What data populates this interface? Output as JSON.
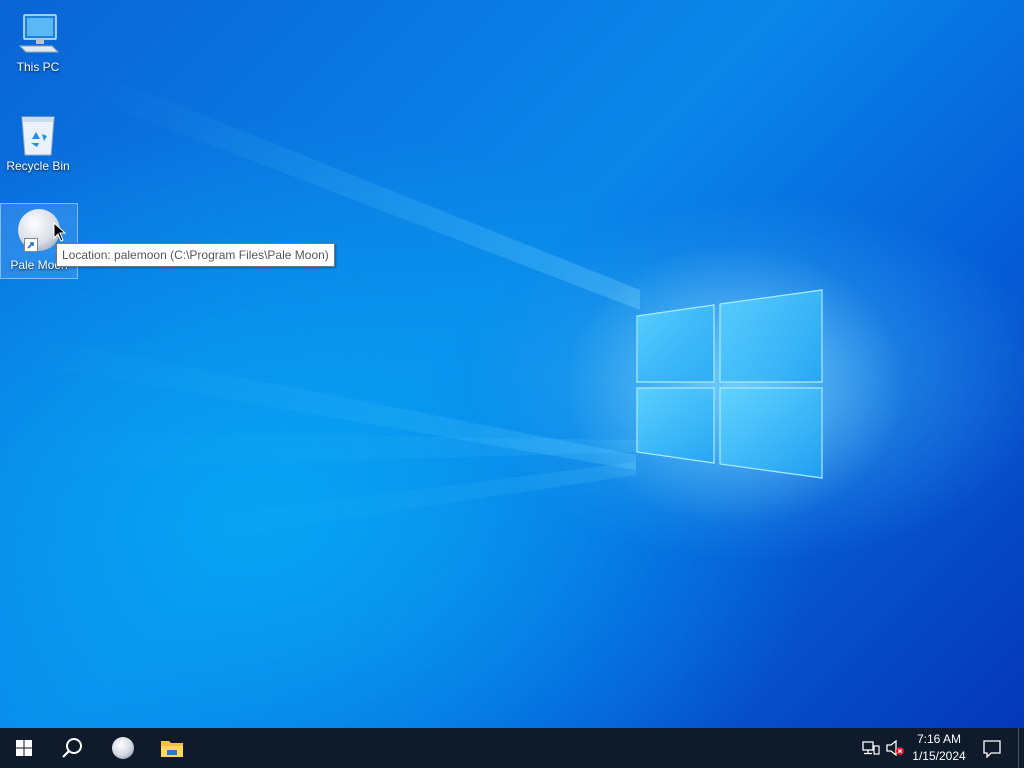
{
  "desktop": {
    "icons": [
      {
        "label": "This PC"
      },
      {
        "label": "Recycle Bin"
      },
      {
        "label": "Pale Moon"
      }
    ],
    "tooltip": "Location: palemoon (C:\\Program Files\\Pale Moon)"
  },
  "taskbar": {
    "clock": {
      "time": "7:16 AM",
      "date": "1/15/2024"
    },
    "pinned": [
      "start-button",
      "search-icon",
      "pale-moon-app",
      "file-explorer-app"
    ],
    "tray_icons": [
      "network-icon",
      "volume-muted-icon",
      "action-center-icon"
    ]
  },
  "colors": {
    "taskbar": "#0f1b2b",
    "desktop_accent": "#0a87e9",
    "tooltip_bg": "#ffffff"
  }
}
